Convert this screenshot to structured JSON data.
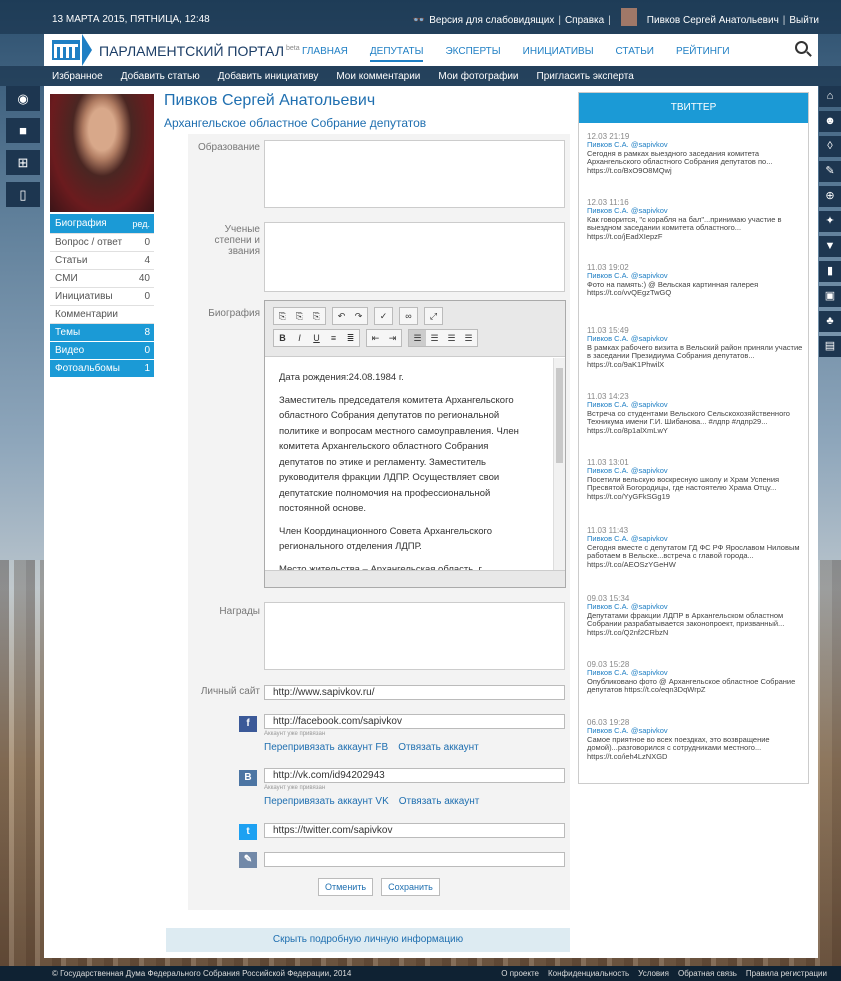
{
  "topbar": {
    "date": "13 МАРТА 2015, ПЯТНИЦА, 12:48",
    "accessibility": "Версия для слабовидящих",
    "help": "Справка",
    "user": "Пивков Сергей Анатольевич",
    "logout": "Выйти"
  },
  "header": {
    "brand": "ПАРЛАМЕНТСКИЙ ПОРТАЛ",
    "beta": "beta",
    "nav": [
      "ГЛАВНАЯ",
      "ДЕПУТАТЫ",
      "ЭКСПЕРТЫ",
      "ИНИЦИАТИВЫ",
      "СТАТЬИ",
      "РЕЙТИНГИ"
    ],
    "active_nav": "ДЕПУТАТЫ"
  },
  "subnav": [
    "Избранное",
    "Добавить статью",
    "Добавить инициативу",
    "Мои комментарии",
    "Мои фотографии",
    "Пригласить эксперта"
  ],
  "profile": {
    "name": "Пивков Сергей Анатольевич",
    "org": "Архангельское областное Собрание депутатов"
  },
  "sidebar": {
    "bio": "Биография",
    "edit": "ред.",
    "items": [
      {
        "label": "Вопрос / ответ",
        "count": "0"
      },
      {
        "label": "Статьи",
        "count": "4"
      },
      {
        "label": "СМИ",
        "count": "40"
      },
      {
        "label": "Инициативы",
        "count": "0"
      },
      {
        "label": "Комментарии",
        "count": ""
      }
    ],
    "blue_items": [
      {
        "label": "Темы",
        "count": "8"
      },
      {
        "label": "Видео",
        "count": "0"
      },
      {
        "label": "Фотоальбомы",
        "count": "1"
      }
    ]
  },
  "form": {
    "education_label": "Образование",
    "degrees_label": "Ученые степени и звания",
    "bio_label": "Биография",
    "awards_label": "Награды",
    "site_label": "Личный сайт",
    "site_value": "http://www.sapivkov.ru/",
    "fb_value": "http://facebook.com/sapivkov",
    "vk_value": "http://vk.com/id94202943",
    "tw_value": "https://twitter.com/sapivkov",
    "other_value": "",
    "linked_note": "Аккаунт уже привязан",
    "fb_relink": "Перепривязать аккаунт FB",
    "vk_relink": "Перепривязать аккаунт VK",
    "unlink": "Отвязать аккаунт",
    "cancel": "Отменить",
    "save": "Сохранить"
  },
  "bio_text": [
    "Дата рождения:24.08.1984 г.",
    "Заместитель председателя комитета Архангельского областного Собрания депутатов по региональной политике и вопросам местного самоуправления. Член комитета Архангельского областного Собрания депутатов по этике и регламенту. Заместитель руководителя фракции ЛДПР. Осуществляет свои депутатские полномочия на профессиональной постоянной основе.",
    "Член Координационного Совета Архангельского регионального отделения ЛДПР.",
    "Место жительства – Архангельская область, г. Новодвинск. Имеет два высших образования. Первое –"
  ],
  "hide_button": "Скрыть подробную личную информацию",
  "twitter": {
    "title": "ТВИТТЕР",
    "tweets": [
      {
        "date": "12.03 21:19",
        "author": "Пивков С.А. @sapivkov",
        "text": "Сегодня в рамках выездного заседания комитета Архангельского областного Собрания депутатов по... https://t.co/BxO9O8MQwj"
      },
      {
        "date": "12.03 11:16",
        "author": "Пивков С.А. @sapivkov",
        "text": "Как говорится, \"с корабля на бал\"...принимаю участие в выездном заседании комитета областного... https://t.co/jEadXIepzF"
      },
      {
        "date": "11.03 19:02",
        "author": "Пивков С.А. @sapivkov",
        "text": "Фото на память:) @ Вельская картинная галерея https://t.co/vvQEgzTwGQ"
      },
      {
        "date": "11.03 15:49",
        "author": "Пивков С.А. @sapivkov",
        "text": "В рамках рабочего визита в Вельский район приняли участие в заседании Президиума Собрания депутатов... https://t.co/9aK1PhwilX"
      },
      {
        "date": "11.03 14:23",
        "author": "Пивков С.А. @sapivkov",
        "text": "Встреча со студентами Вельского Сельскохозяйственного Техникума имени Г.И. Шибанова... #лдпр #лдпр29... https://t.co/8p1alXmLwY"
      },
      {
        "date": "11.03 13:01",
        "author": "Пивков С.А. @sapivkov",
        "text": "Посетили вельскую воскресную школу и Храм Успения Пресвятой Богородицы, где настоятелю Храма Отцу... https://t.co/YyGFkSGg19"
      },
      {
        "date": "11.03 11:43",
        "author": "Пивков С.А. @sapivkov",
        "text": "Сегодня вместе с депутатом ГД ФС РФ Ярославом Ниловым работаем в Вельске...встреча с главой города... https://t.co/AEOSzYGeHW"
      },
      {
        "date": "09.03 15:34",
        "author": "Пивков С.А. @sapivkov",
        "text": "Депутатами фракции ЛДПР в Архангельском областном Собрании разрабатывается законопроект, призванный... https://t.co/Q2nf2CRbzN"
      },
      {
        "date": "09.03 15:28",
        "author": "Пивков С.А. @sapivkov",
        "text": "Опубликовано фото @ Архангельское областное Собрание депутатов https://t.co/eqn3DqWrpZ"
      },
      {
        "date": "06.03 19:28",
        "author": "Пивков С.А. @sapivkov",
        "text": "Самое приятное во всех поездках, это возвращение домой)...разговорился с сотрудниками местного... https://t.co/ieh4LzNXGD"
      }
    ]
  },
  "footer": {
    "copyright": "© Государственная Дума Федерального Собрания Российской Федерации, 2014",
    "links": [
      "О проекте",
      "Конфиденциальность",
      "Условия",
      "Обратная связь",
      "Правила регистрации"
    ]
  },
  "colors": {
    "accent": "#1b9ad6",
    "dark": "#1d3650"
  }
}
